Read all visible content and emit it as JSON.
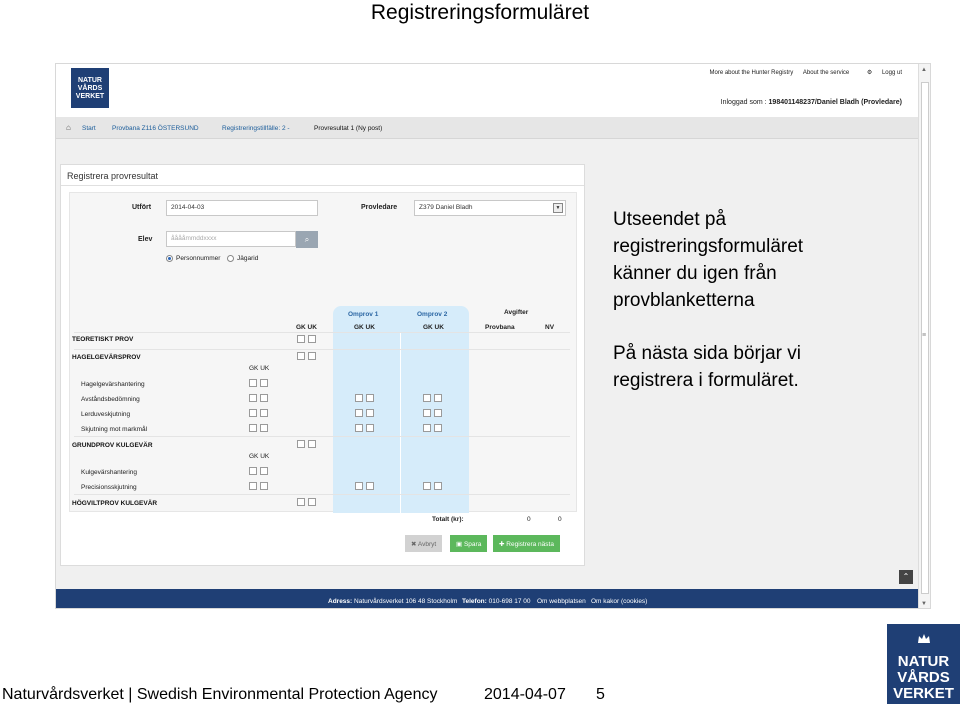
{
  "slide": {
    "title": "Registreringsformuläret",
    "callout_1": [
      "Utseendet på",
      "registreringsformuläret",
      "känner du igen från",
      "provblanketterna"
    ],
    "callout_2": [
      "På nästa sida börjar vi",
      "registrera i formuläret."
    ],
    "footer_org": "Naturvårdsverket | Swedish Environmental Protection Agency",
    "footer_date": "2014-04-07",
    "page_number": "5",
    "logo_lines": [
      "NATUR",
      "VÅRDS",
      "VERKET"
    ]
  },
  "app": {
    "logo_lines": [
      "NATUR",
      "VÅRDS",
      "VERKET"
    ],
    "top_links": [
      "More about the Hunter Registry",
      "About the service",
      "Logg ut"
    ],
    "logged_in_label": "Inloggad som :",
    "logged_in_user": "198401148237/Daniel Bladh (Provledare)",
    "breadcrumb": [
      "Start",
      "Provbana Z116 ÖSTERSUND",
      "Registreringstillfälle: 2 -",
      "Provresultat 1 (Ny post)"
    ],
    "panel_title": "Registrera provresultat",
    "form": {
      "utfort_label": "Utfört",
      "utfort_value": "2014-04-03",
      "provledare_label": "Provledare",
      "provledare_value": "Z379 Daniel Bladh",
      "elev_label": "Elev",
      "elev_placeholder": "ååååmmddxxxx",
      "radio_personnummer": "Personnummer",
      "radio_jagarid": "Jägarid"
    },
    "columns": {
      "omprov1": "Omprov 1",
      "omprov2": "Omprov 2",
      "avgifter": "Avgifter",
      "gk": "GK UK",
      "provbana": "Provbana",
      "nv": "NV"
    },
    "sections": {
      "teoretiskt": "TEORETISKT PROV",
      "hagelgevar": "HAGELGEVÄRSPROV",
      "grundprov": "GRUNDPROV KULGEVÄR",
      "hogvilt": "HÖGVILTPROV KULGEVÄR"
    },
    "hagel_items": [
      "Hagelgevärshantering",
      "Avståndsbedömning",
      "Lerduveskjutning",
      "Skjutning mot markmål"
    ],
    "kul_items": [
      "Kulgevärshantering",
      "Precisionsskjutning"
    ],
    "total_label": "Totalt (kr):",
    "total_provbana": "0",
    "total_nv": "0",
    "buttons": {
      "avbryt": "Avbryt",
      "spara": "Spara",
      "registrera": "Registrera nästa"
    },
    "footer": {
      "adress_label": "Adress:",
      "adress": "Naturvårdsverket 106 48 Stockholm",
      "telefon_label": "Telefon:",
      "telefon": "010-698 17 00",
      "webb": "Om webbplatsen",
      "kakor": "Om kakor (cookies)"
    }
  }
}
